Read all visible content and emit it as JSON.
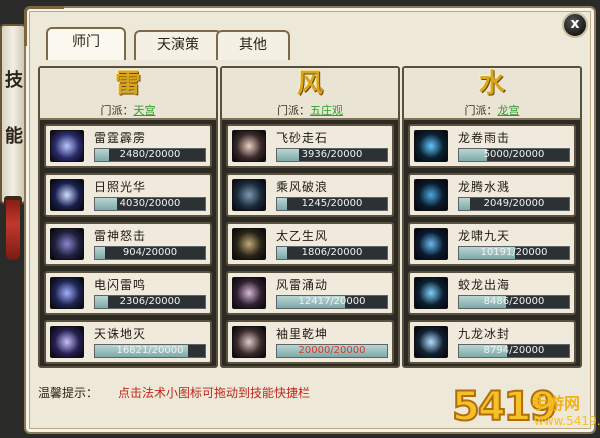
{
  "window": {
    "banner_chars": [
      "技",
      "能"
    ],
    "close_label": "x"
  },
  "tabs": [
    {
      "label": "师门",
      "active": true
    },
    {
      "label": "天演策",
      "active": false
    },
    {
      "label": "其他",
      "active": false
    }
  ],
  "columns": [
    {
      "school": "雷",
      "sect_label": "门派：",
      "sect": "天宫",
      "skills": [
        {
          "name": "雷霆霹雳",
          "value": 2480,
          "max": 20000,
          "text": "2480/20000",
          "icon": "lightning-storm-icon",
          "c1": "#2a2a6a",
          "c2": "#b8c8ff"
        },
        {
          "name": "日照光华",
          "value": 4030,
          "max": 20000,
          "text": "4030/20000",
          "icon": "sun-beam-icon",
          "c1": "#1a2050",
          "c2": "#d0e0ff"
        },
        {
          "name": "雷神怒击",
          "value": 904,
          "max": 20000,
          "text": "904/20000",
          "icon": "thunder-strike-icon",
          "c1": "#202040",
          "c2": "#8888cc"
        },
        {
          "name": "电闪雷鸣",
          "value": 2306,
          "max": 20000,
          "text": "2306/20000",
          "icon": "flash-thunder-icon",
          "c1": "#1e2450",
          "c2": "#a0b0ff"
        },
        {
          "name": "天诛地灭",
          "value": 16821,
          "max": 20000,
          "text": "16821/20000",
          "icon": "heaven-strike-icon",
          "c1": "#262050",
          "c2": "#c8c0ff"
        }
      ]
    },
    {
      "school": "风",
      "sect_label": "门派：",
      "sect": "五庄观",
      "skills": [
        {
          "name": "飞砂走石",
          "value": 3936,
          "max": 20000,
          "text": "3936/20000",
          "icon": "flying-sand-icon",
          "c1": "#3a2a2a",
          "c2": "#e8d0c0"
        },
        {
          "name": "乘风破浪",
          "value": 1245,
          "max": 20000,
          "text": "1245/20000",
          "icon": "wind-wave-icon",
          "c1": "#1a2a3a",
          "c2": "#7a9ab0"
        },
        {
          "name": "太乙生风",
          "value": 1806,
          "max": 20000,
          "text": "1806/20000",
          "icon": "wind-vortex-icon",
          "c1": "#2a2418",
          "c2": "#c0a878"
        },
        {
          "name": "风雷涌动",
          "value": 12417,
          "max": 20000,
          "text": "12417/20000",
          "icon": "wind-thunder-icon",
          "c1": "#302030",
          "c2": "#d8b8d8"
        },
        {
          "name": "袖里乾坤",
          "value": 20000,
          "max": 20000,
          "text": "20000/20000",
          "icon": "sleeve-universe-icon",
          "c1": "#3a2a2a",
          "c2": "#e0c8c8",
          "red": true
        }
      ]
    },
    {
      "school": "水",
      "sect_label": "门派：",
      "sect": "龙宫",
      "skills": [
        {
          "name": "龙卷雨击",
          "value": 5000,
          "max": 20000,
          "text": "5000/20000",
          "icon": "tornado-rain-icon",
          "c1": "#0a2030",
          "c2": "#60c8ff"
        },
        {
          "name": "龙腾水溅",
          "value": 2049,
          "max": 20000,
          "text": "2049/20000",
          "icon": "dragon-splash-icon",
          "c1": "#0a1a2a",
          "c2": "#4aa8e0"
        },
        {
          "name": "龙啸九天",
          "value": 10191,
          "max": 20000,
          "text": "10191/20000",
          "icon": "dragon-roar-icon",
          "c1": "#0a1a30",
          "c2": "#6ab8f0"
        },
        {
          "name": "蛟龙出海",
          "value": 8486,
          "max": 20000,
          "text": "8486/20000",
          "icon": "sea-dragon-icon",
          "c1": "#0a2030",
          "c2": "#80d0ff"
        },
        {
          "name": "九龙冰封",
          "value": 8794,
          "max": 20000,
          "text": "8794/20000",
          "icon": "ice-dragon-icon",
          "c1": "#102030",
          "c2": "#b0e0ff"
        }
      ]
    }
  ],
  "footer": {
    "tip_label": "温馨提示：",
    "tip_text": "点击法术小图标可拖动到技能快捷栏"
  },
  "watermark": {
    "number": "5419",
    "site": "手游网",
    "url": "www.5419.com"
  }
}
